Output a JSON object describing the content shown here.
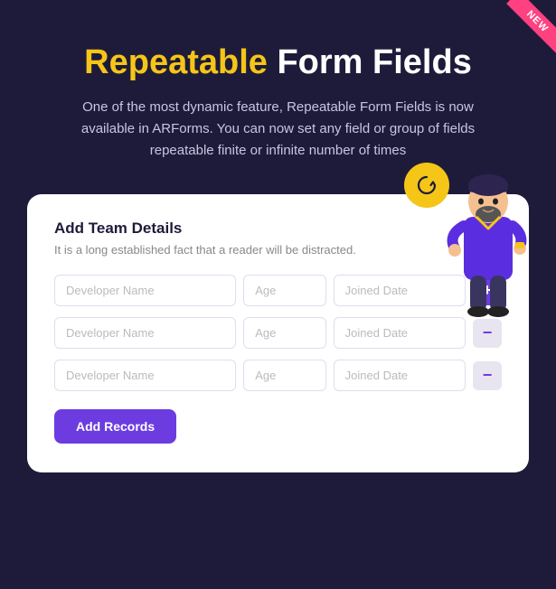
{
  "badge": {
    "label": "NEW"
  },
  "header": {
    "title_highlight": "Repeatable",
    "title_rest": " Form Fields",
    "subtitle": "One of the most dynamic feature, Repeatable Form Fields is now available in ARForms. You can now set any field or group of fields repeatable finite or infinite number of times"
  },
  "card": {
    "title": "Add Team Details",
    "subtitle": "It is a long established fact that a reader will be distracted.",
    "rows": [
      {
        "developer_placeholder": "Developer Name",
        "age_placeholder": "Age",
        "date_placeholder": "Joined Date",
        "action": "add"
      },
      {
        "developer_placeholder": "Developer Name",
        "age_placeholder": "Age",
        "date_placeholder": "Joined Date",
        "action": "remove"
      },
      {
        "developer_placeholder": "Developer Name",
        "age_placeholder": "Age",
        "date_placeholder": "Joined Date",
        "action": "remove"
      }
    ],
    "add_records_label": "Add Records"
  },
  "colors": {
    "accent": "#6c3ce1",
    "yellow": "#f5c518",
    "pink": "#ff4081"
  }
}
